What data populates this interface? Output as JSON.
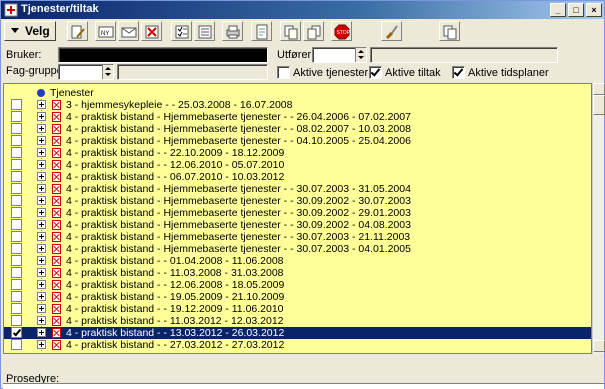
{
  "window": {
    "title": "Tjenester/tiltak"
  },
  "toolbar": {
    "velg_label": "Velg"
  },
  "form": {
    "bruker_label": "Bruker:",
    "faggruppe_label": "Fag-gruppe:",
    "utforer_label": "Utfører:",
    "aktive_tjenester_label": "Aktive tjenester",
    "aktive_tiltak_label": "Aktive tiltak",
    "aktive_tidsplaner_label": "Aktive tidsplaner",
    "aktive_tjenester_checked": false,
    "aktive_tiltak_checked": true,
    "aktive_tidsplaner_checked": true
  },
  "tree": {
    "root_label": "Tjenester",
    "items": [
      {
        "text": "3 - hjemmesykepleie - - 25.03.2008 - 16.07.2008",
        "checked": false,
        "selected": false
      },
      {
        "text": "4 - praktisk bistand - Hjemmebaserte tjenester - - 26.04.2006 - 07.02.2007",
        "checked": false,
        "selected": false
      },
      {
        "text": "4 - praktisk bistand - Hjemmebaserte tjenester - - 08.02.2007 - 10.03.2008",
        "checked": false,
        "selected": false
      },
      {
        "text": "4 - praktisk bistand - Hjemmebaserte tjenester - - 04.10.2005 - 25.04.2006",
        "checked": false,
        "selected": false
      },
      {
        "text": "4 - praktisk bistand - - 22.10.2009 - 18.12.2009",
        "checked": false,
        "selected": false
      },
      {
        "text": "4 - praktisk bistand - - 12.06.2010 - 05.07.2010",
        "checked": false,
        "selected": false
      },
      {
        "text": "4 - praktisk bistand - - 06.07.2010 - 10.03.2012",
        "checked": false,
        "selected": false
      },
      {
        "text": "4 - praktisk bistand - Hjemmebaserte tjenester - - 30.07.2003 - 31.05.2004",
        "checked": false,
        "selected": false
      },
      {
        "text": "4 - praktisk bistand - Hjemmebaserte tjenester - - 30.09.2002 - 30.07.2003",
        "checked": false,
        "selected": false
      },
      {
        "text": "4 - praktisk bistand - Hjemmebaserte tjenester - - 30.09.2002 - 29.01.2003",
        "checked": false,
        "selected": false
      },
      {
        "text": "4 - praktisk bistand - Hjemmebaserte tjenester - - 30.09.2002 - 04.08.2003",
        "checked": false,
        "selected": false
      },
      {
        "text": "4 - praktisk bistand - Hjemmebaserte tjenester - - 30.07.2003 - 21.11.2003",
        "checked": false,
        "selected": false
      },
      {
        "text": "4 - praktisk bistand - Hjemmebaserte tjenester - - 30.07.2003 - 04.01.2005",
        "checked": false,
        "selected": false
      },
      {
        "text": "4 - praktisk bistand - - 01.04.2008 - 11.06.2008",
        "checked": false,
        "selected": false
      },
      {
        "text": "4 - praktisk bistand - - 11.03.2008 - 31.03.2008",
        "checked": false,
        "selected": false
      },
      {
        "text": "4 - praktisk bistand - - 12.06.2008 - 18.05.2009",
        "checked": false,
        "selected": false
      },
      {
        "text": "4 - praktisk bistand - - 19.05.2009 - 21.10.2009",
        "checked": false,
        "selected": false
      },
      {
        "text": "4 - praktisk bistand - - 19.12.2009 - 11.06.2010",
        "checked": false,
        "selected": false
      },
      {
        "text": "4 - praktisk bistand - - 11.03.2012 - 12.03.2012",
        "checked": false,
        "selected": false
      },
      {
        "text": "4 - praktisk bistand - - 13.03.2012 - 26.03.2012",
        "checked": true,
        "selected": true
      },
      {
        "text": "4 - praktisk bistand - - 27.03.2012 - 27.03.2012",
        "checked": false,
        "selected": false
      }
    ]
  },
  "bottom": {
    "prosedyre_label": "Prosedyre:"
  }
}
